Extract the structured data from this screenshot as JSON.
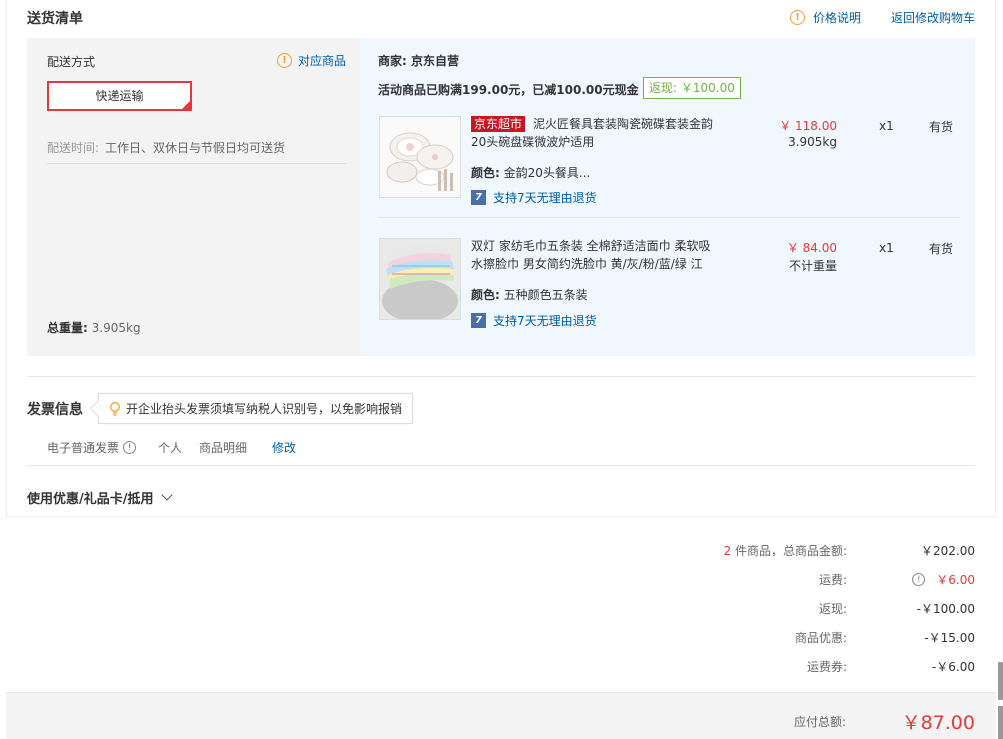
{
  "section": {
    "title": "送货清单",
    "price_note": "价格说明",
    "back_to_cart": "返回修改购物车"
  },
  "shipping": {
    "label": "配送方式",
    "match_goods": "对应商品",
    "method": "快递运输",
    "time_label": "配送时间:",
    "time_value": "工作日、双休日与节假日均可送货",
    "weight_label": "总重量:",
    "weight_value": "3.905kg"
  },
  "goods": {
    "merchant": "商家: 京东自营",
    "promo": "活动商品已购满199.00元，已减100.00元现金",
    "cashback": "返现: ￥100.00",
    "items": [
      {
        "tag": "京东超市",
        "name": "泥火匠餐具套装陶瓷碗碟套装金韵20头碗盘碟微波炉适用",
        "color_label": "颜色:",
        "color": "金韵20头餐具...",
        "service": "支持7天无理由退货",
        "price": "￥ 118.00",
        "weight": "3.905kg",
        "qty": "x1",
        "stock": "有货",
        "thumb_icon": "ceramic-dishes-image"
      },
      {
        "tag": "",
        "name": "双灯 家纺毛巾五条装 全棉舒适洁面巾 柔软吸水擦脸巾 男女简约洗脸巾 黄/灰/粉/蓝/绿 江",
        "color_label": "颜色:",
        "color": "五种颜色五条装",
        "service": "支持7天无理由退货",
        "price": "￥ 84.00",
        "weight": "不计重量",
        "qty": "x1",
        "stock": "有货",
        "thumb_icon": "towels-image"
      }
    ]
  },
  "invoice": {
    "title": "发票信息",
    "tip": "开企业抬头发票须填写纳税人识别号，以免影响报销",
    "type": "电子普通发票",
    "holder": "个人",
    "content": "商品明细",
    "edit": "修改"
  },
  "coupon": {
    "title": "使用优惠/礼品卡/抵用"
  },
  "summary": {
    "count": "2",
    "count_label": "件商品，总商品金额:",
    "goods_total": "￥202.00",
    "fee_label": "运费:",
    "fee_value": "￥6.00",
    "cashback_label": "返现:",
    "cashback_value": "-￥100.00",
    "discount_label": "商品优惠:",
    "discount_value": "-￥15.00",
    "fee_coupon_label": "运费券:",
    "fee_coupon_value": "-￥6.00",
    "total_label": "应付总额:",
    "total_value": "￥87.00"
  },
  "colors": {
    "accent_red": "#e4393c",
    "link_blue": "#005ea7",
    "cashback_green": "#71b247",
    "warn_orange": "#f0a030"
  }
}
